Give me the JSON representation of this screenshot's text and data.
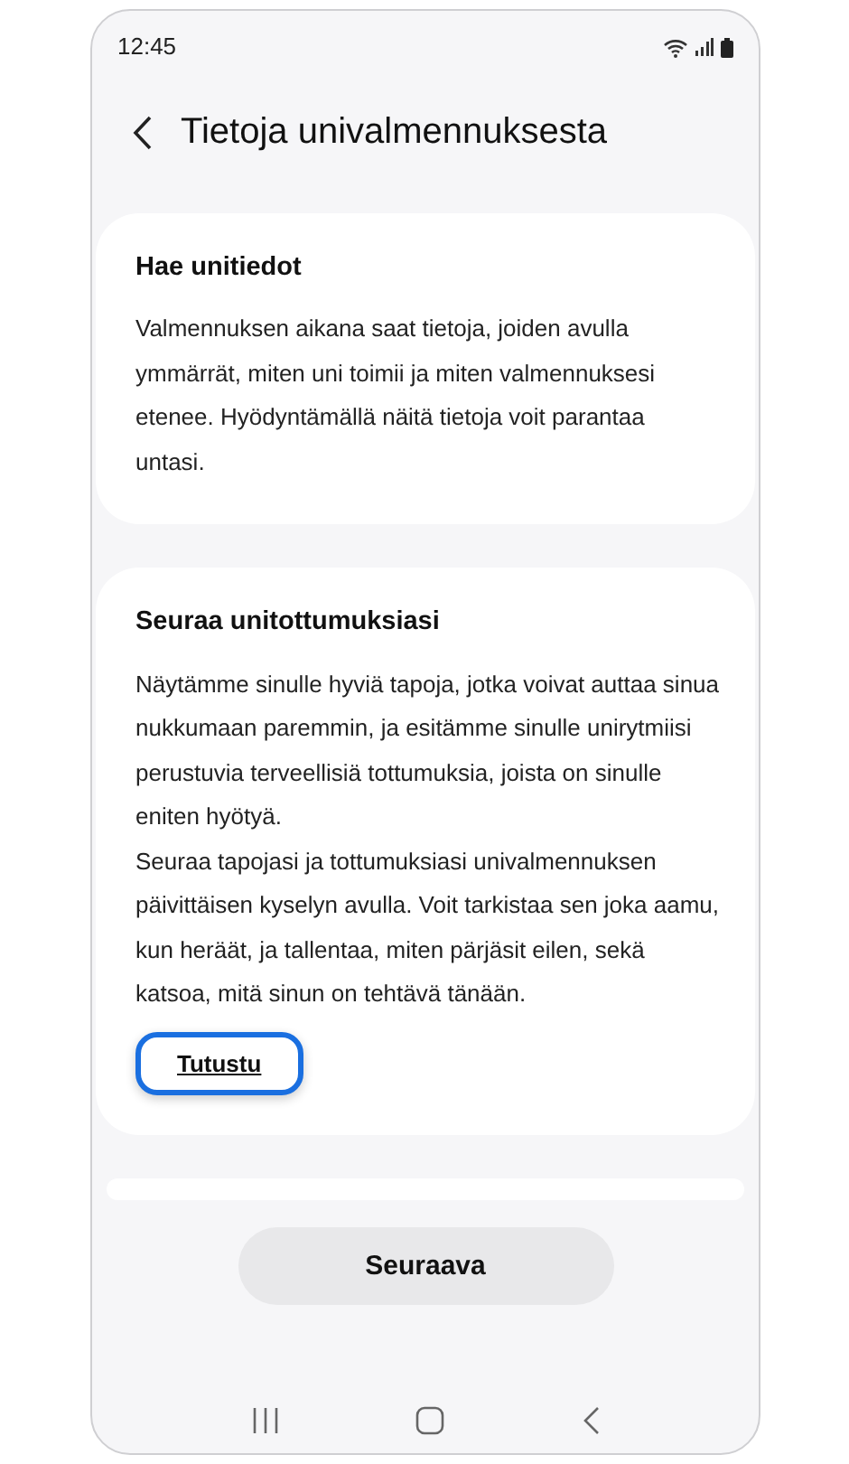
{
  "status_bar": {
    "time": "12:45"
  },
  "header": {
    "title": "Tietoja univalmennuksesta"
  },
  "cards": [
    {
      "title": "Hae unitiedot",
      "paragraphs": [
        "Valmennuksen aikana saat tietoja, joiden avulla ymmärrät, miten uni toimii ja miten valmennuksesi etenee. Hyödyntämällä näitä tietoja voit parantaa untasi."
      ]
    },
    {
      "title": "Seuraa unitottumuksiasi",
      "paragraphs": [
        "Näytämme sinulle hyviä tapoja, jotka voivat auttaa sinua nukkumaan paremmin, ja esitämme sinulle unirytmiisi perustuvia terveellisiä tottumuksia, joista on sinulle eniten hyötyä.",
        "Seuraa tapojasi ja tottumuksiasi univalmennuksen päivittäisen kyselyn avulla. Voit tarkistaa sen joka aamu, kun heräät, ja tallentaa, miten pärjäsit eilen, sekä katsoa, mitä sinun on tehtävä tänään."
      ],
      "link": {
        "label": "Tutustu",
        "highlighted": true
      }
    }
  ],
  "next_button": {
    "label": "Seuraava"
  }
}
